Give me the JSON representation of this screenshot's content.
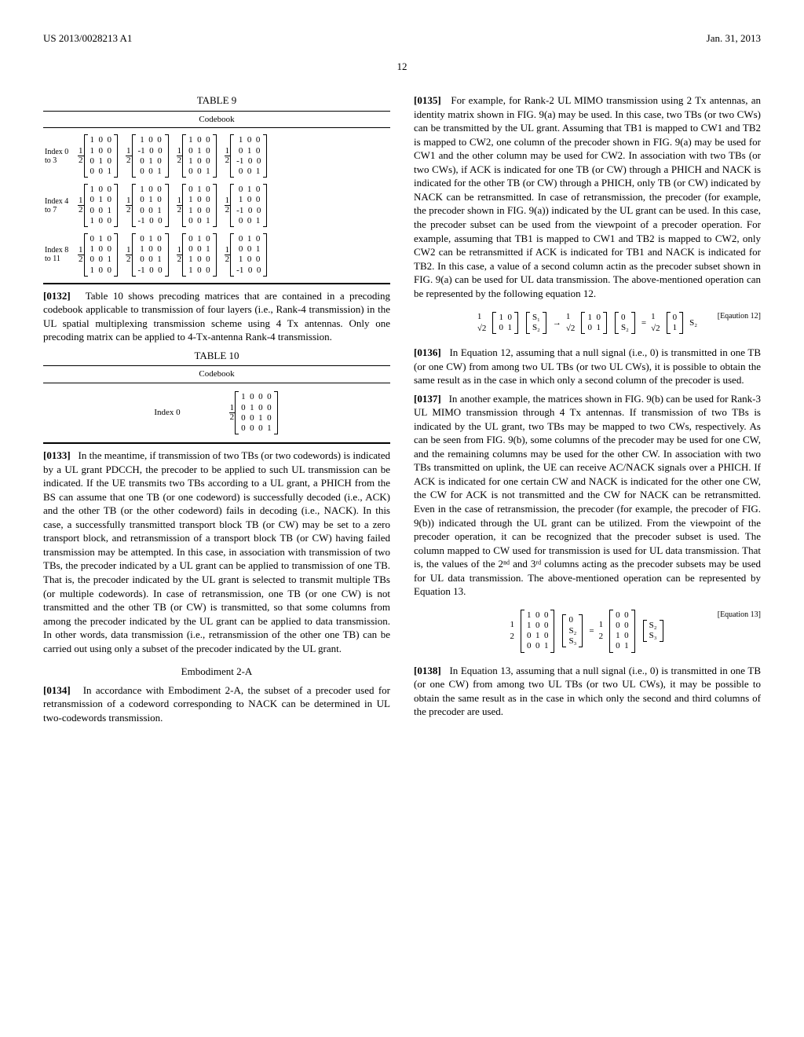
{
  "header": {
    "left": "US 2013/0028213 A1",
    "right": "Jan. 31, 2013"
  },
  "pagenum": "12",
  "table9": {
    "title": "TABLE 9",
    "subtitle": "Codebook",
    "rows": [
      {
        "label": "Index 0 to 3",
        "matrices": [
          {
            "scalar": "1/2",
            "rows": [
              "1  0  0",
              "1  0  0",
              "0  1  0",
              "0  0  1"
            ]
          },
          {
            "scalar": "1/2",
            "rows": [
              " 1  0  0",
              "-1  0  0",
              " 0  1  0",
              " 0  0  1"
            ]
          },
          {
            "scalar": "1/2",
            "rows": [
              "1  0  0",
              "0  1  0",
              "1  0  0",
              "0  0  1"
            ]
          },
          {
            "scalar": "1/2",
            "rows": [
              " 1  0  0",
              " 0  1  0",
              "-1  0  0",
              " 0  0  1"
            ]
          }
        ]
      },
      {
        "label": "Index 4 to 7",
        "matrices": [
          {
            "scalar": "1/2",
            "rows": [
              "1  0  0",
              "0  1  0",
              "0  0  1",
              "1  0  0"
            ]
          },
          {
            "scalar": "1/2",
            "rows": [
              " 1  0  0",
              " 0  1  0",
              " 0  0  1",
              "-1  0  0"
            ]
          },
          {
            "scalar": "1/2",
            "rows": [
              "0  1  0",
              "1  0  0",
              "1  0  0",
              "0  0  1"
            ]
          },
          {
            "scalar": "1/2",
            "rows": [
              " 0  1  0",
              " 1  0  0",
              "-1  0  0",
              " 0  0  1"
            ]
          }
        ]
      },
      {
        "label": "Index 8 to 11",
        "matrices": [
          {
            "scalar": "1/2",
            "rows": [
              "0  1  0",
              "1  0  0",
              "0  0  1",
              "1  0  0"
            ]
          },
          {
            "scalar": "1/2",
            "rows": [
              " 0  1  0",
              " 1  0  0",
              " 0  0  1",
              "-1  0  0"
            ]
          },
          {
            "scalar": "1/2",
            "rows": [
              "0  1  0",
              "0  0  1",
              "1  0  0",
              "1  0  0"
            ]
          },
          {
            "scalar": "1/2",
            "rows": [
              " 0  1  0",
              " 0  0  1",
              " 1  0  0",
              "-1  0  0"
            ]
          }
        ]
      }
    ]
  },
  "p0132": {
    "num": "[0132]",
    "text": "Table 10 shows precoding matrices that are contained in a precoding codebook applicable to transmission of four layers (i.e., Rank-4 transmission) in the UL spatial multiplexing transmission scheme using 4 Tx antennas. Only one precoding matrix can be applied to 4-Tx-antenna Rank-4 transmission."
  },
  "table10": {
    "title": "TABLE 10",
    "subtitle": "Codebook",
    "indexLabel": "Index 0",
    "matrix": {
      "scalar": "1/2",
      "rows": [
        "1  0  0  0",
        "0  1  0  0",
        "0  0  1  0",
        "0  0  0  1"
      ]
    }
  },
  "p0133": {
    "num": "[0133]",
    "text": "In the meantime, if transmission of two TBs (or two codewords) is indicated by a UL grant PDCCH, the precoder to be applied to such UL transmission can be indicated. If the UE transmits two TBs according to a UL grant, a PHICH from the BS can assume that one TB (or one codeword) is successfully decoded (i.e., ACK) and the other TB (or the other codeword) fails in decoding (i.e., NACK). In this case, a successfully transmitted transport block TB (or CW) may be set to a zero transport block, and retransmission of a transport block TB (or CW) having failed transmission may be attempted. In this case, in association with transmission of two TBs, the precoder indicated by a UL grant can be applied to transmission of one TB. That is, the precoder indicated by the UL grant is selected to transmit multiple TBs (or multiple codewords). In case of retransmission, one TB (or one CW) is not transmitted and the other TB (or CW) is transmitted, so that some columns from among the precoder indicated by the UL grant can be applied to data transmission. In other words, data transmission (i.e., retransmission of the other one TB) can be carried out using only a subset of the precoder indicated by the UL grant."
  },
  "embHead": "Embodiment 2-A",
  "p0134": {
    "num": "[0134]",
    "text": "In accordance with Embodiment 2-A, the subset of a precoder used for retransmission of a codeword corresponding to NACK can be determined in UL two-codewords transmission."
  },
  "p0135": {
    "num": "[0135]",
    "text": "For example, for Rank-2 UL MIMO transmission using 2 Tx antennas, an identity matrix shown in FIG. 9(a) may be used. In this case, two TBs (or two CWs) can be transmitted by the UL grant. Assuming that TB1 is mapped to CW1 and TB2 is mapped to CW2, one column of the precoder shown in FIG. 9(a) may be used for CW1 and the other column may be used for CW2. In association with two TBs (or two CWs), if ACK is indicated for one TB (or CW) through a PHICH and NACK is indicated for the other TB (or CW) through a PHICH, only TB (or CW) indicated by NACK can be retransmitted. In case of retransmission, the precoder (for example, the precoder shown in FIG. 9(a)) indicated by the UL grant can be used. In this case, the precoder subset can be used from the viewpoint of a precoder operation. For example, assuming that TB1 is mapped to CW1 and TB2 is mapped to CW2, only CW2 can be retransmitted if ACK is indicated for TB1 and NACK is indicated for TB2. In this case, a value of a second column actin as the precoder subset shown in FIG. 9(a) can be used for UL data transmission. The above-mentioned operation can be represented by the following equation 12."
  },
  "eq12": {
    "label": "[Eqaution 12]",
    "lhsScalar": "1/√2",
    "lhsM": [
      "1  0",
      "0  1"
    ],
    "lhsV": [
      "S₁",
      "S₂"
    ],
    "arrow": "→",
    "midScalar": "1/√2",
    "midM": [
      "1  0",
      "0  1"
    ],
    "midV": [
      "0",
      "S₂"
    ],
    "eq": "=",
    "rhsScalar": "1/√2",
    "rhsM": [
      "0",
      "1"
    ],
    "rhsSym": "S₂"
  },
  "p0136": {
    "num": "[0136]",
    "text": "In Equation 12, assuming that a null signal (i.e., 0) is transmitted in one TB (or one CW) from among two UL TBs (or two UL CWs), it is possible to obtain the same result as in the case in which only a second column of the precoder is used."
  },
  "p0137": {
    "num": "[0137]",
    "text": "In another example, the matrices shown in FIG. 9(b) can be used for Rank-3 UL MIMO transmission through 4 Tx antennas. If transmission of two TBs is indicated by the UL grant, two TBs may be mapped to two CWs, respectively. As can be seen from FIG. 9(b), some columns of the precoder may be used for one CW, and the remaining columns may be used for the other CW. In association with two TBs transmitted on uplink, the UE can receive AC/NACK signals over a PHICH. If ACK is indicated for one certain CW and NACK is indicated for the other one CW, the CW for ACK is not transmitted and the CW for NACK can be retransmitted. Even in the case of retransmission, the precoder (for example, the precoder of FIG. 9(b)) indicated through the UL grant can be utilized. From the viewpoint of the precoder operation, it can be recognized that the precoder subset is used. The column mapped to CW used for transmission is used for UL data transmission. That is, the values of the 2ⁿᵈ and 3ʳᵈ columns acting as the precoder subsets may be used for UL data transmission. The above-mentioned operation can be represented by Equation 13."
  },
  "eq13": {
    "label": "[Equation 13]",
    "lhsScalar": "1/2",
    "lhsM": [
      "1  0  0",
      "1  0  0",
      "0  1  0",
      "0  0  1"
    ],
    "lhsV": [
      "0",
      "S₂",
      "S₃"
    ],
    "eq": "=",
    "rhsScalar": "1/2",
    "rhsM": [
      "0  0",
      "0  0",
      "1  0",
      "0  1"
    ],
    "rhsV": [
      "S₂",
      "S₃"
    ]
  },
  "p0138": {
    "num": "[0138]",
    "text": "In Equation 13, assuming that a null signal (i.e., 0) is transmitted in one TB (or one CW) from among two UL TBs (or two UL CWs), it may be possible to obtain the same result as in the case in which only the second and third columns of the precoder are used."
  }
}
